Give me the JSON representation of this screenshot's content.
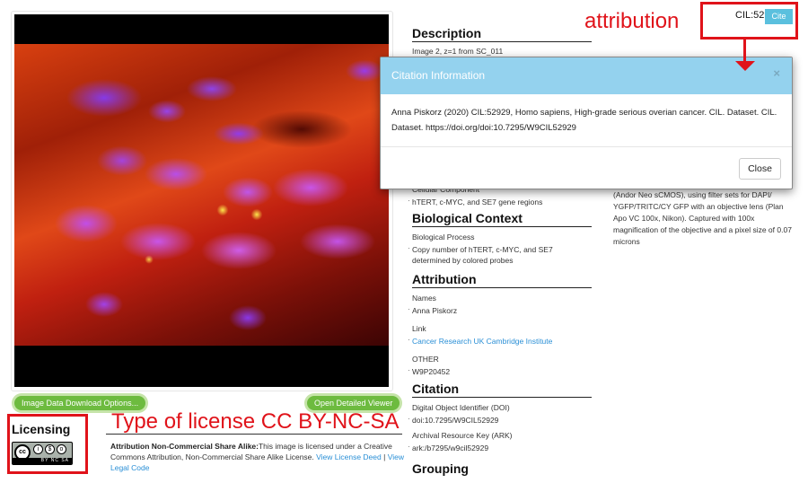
{
  "image_panel": {
    "image_alt": "fluorescence-microscopy-image",
    "download_button": "Image Data Download Options...",
    "viewer_button": "Open Detailed Viewer"
  },
  "licensing": {
    "heading": "Licensing",
    "badge_text": "BY NC SA",
    "badge_icon": "cc-by-nc-sa-icon",
    "title": "Attribution Non-Commercial Share Alike:",
    "text": "This image is licensed under a Creative Commons Attribution, Non-Commercial Share Alike License. ",
    "link_deed": "View License Deed",
    "separator": " | ",
    "link_legal": "View Legal Code"
  },
  "description": {
    "heading": "Description",
    "text": "Image 2, z=1 from SC_011"
  },
  "cellular_component": {
    "label": "Cellular Component",
    "value": "hTERT, c-MYC, and SE7 gene regions"
  },
  "biological_context": {
    "heading": "Biological Context",
    "label": "Biological Process",
    "value": "Copy number of hTERT, c-MYC, and SE7 determined by colored probes"
  },
  "attribution": {
    "heading": "Attribution",
    "names_label": "Names",
    "names_value": "Anna Piskorz",
    "link_label": "Link",
    "link_value": "Cancer Research UK Cambridge Institute",
    "other_label": "OTHER",
    "other_value": "W9P20452"
  },
  "citation": {
    "heading": "Citation",
    "doi_label": "Digital Object Identifier (DOI)",
    "doi_value": "doi:10.7295/W9CIL52929",
    "ark_label": "Archival Resource Key (ARK)",
    "ark_value": "ark:/b7295/w9cil52929"
  },
  "grouping": {
    "heading": "Grouping"
  },
  "right_column": {
    "text": "(Andor Neo sCMOS), using filter sets for DAPI/ YGFP/TRITC/CY GFP with an objective lens (Plan Apo VC 100x, Nikon). Captured with 100x magnification of the objective and a pixel size of 0.07 microns"
  },
  "header": {
    "cil_id": "CIL:52929",
    "cil_sup": "*",
    "cite_button": "Cite"
  },
  "modal": {
    "title": "Citation Information",
    "close_x": "×",
    "body": "Anna Piskorz (2020) CIL:52929, Homo sapiens, High-grade serious overian cancer. CIL. Dataset. CIL. Dataset. https://doi.org/doi:10.7295/W9CIL52929",
    "close_button": "Close"
  },
  "annotations": {
    "attribution_label": "attribution",
    "license_label": "Type of license  CC BY-NC-SA",
    "color": "#e0131a"
  }
}
